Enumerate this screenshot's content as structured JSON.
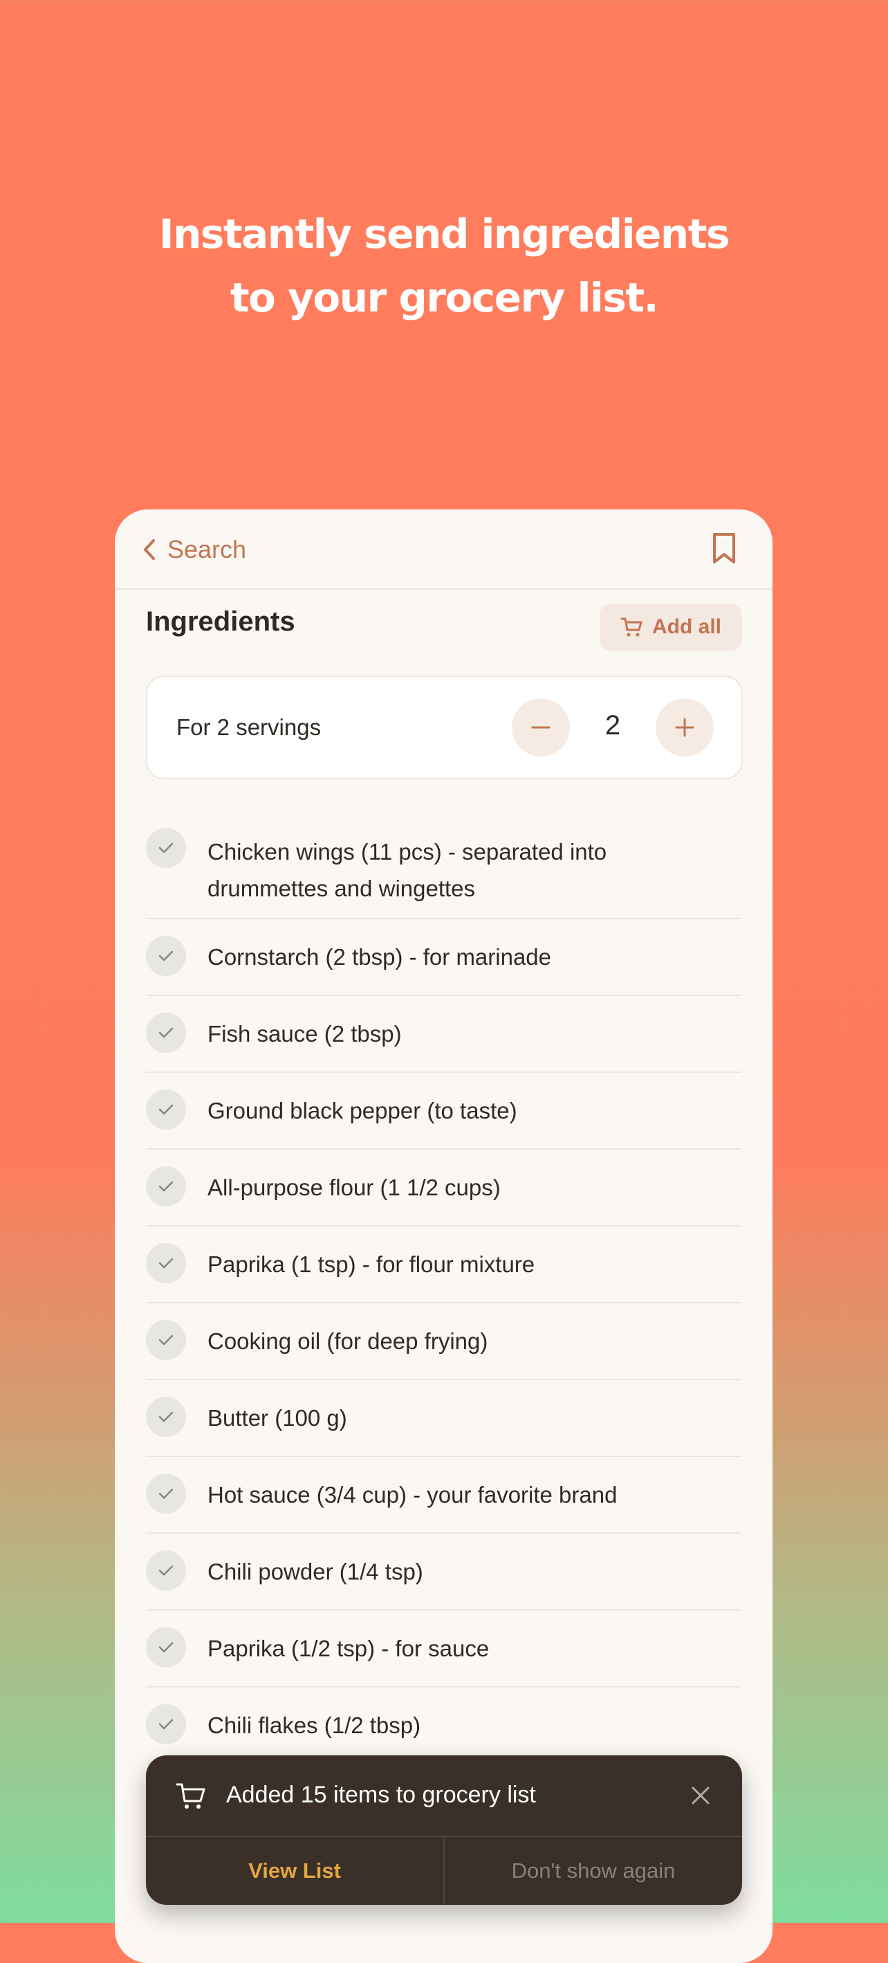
{
  "headline": {
    "line1": "Instantly send ingredients",
    "line2": "to your grocery list."
  },
  "nav": {
    "back_label": "Search",
    "back_icon": "chevron-left-icon",
    "bookmark_icon": "bookmark-icon"
  },
  "ingredients_section": {
    "title": "Ingredients",
    "add_all_label": "Add all",
    "add_all_icon": "cart-icon"
  },
  "servings": {
    "label": "For 2 servings",
    "count": "2"
  },
  "ingredients": [
    "Chicken wings (11 pcs) - separated into drummettes and wingettes",
    "Cornstarch (2 tbsp) - for marinade",
    "Fish sauce (2 tbsp)",
    "Ground black pepper (to taste)",
    "All-purpose flour (1 1/2 cups)",
    "Paprika (1 tsp) - for flour mixture",
    "Cooking oil (for deep frying)",
    "Butter (100 g)",
    "Hot sauce (3/4 cup) - your favorite brand",
    "Chili powder (1/4 tsp)",
    "Paprika (1/2 tsp) - for sauce",
    "Chili flakes (1/2 tbsp)"
  ],
  "toast": {
    "message": "Added 15 items to grocery list",
    "view_list": "View List",
    "dont_show": "Don't show again"
  },
  "colors": {
    "accent": "#C27552",
    "toast_bg": "#3A3028",
    "view_list": "#E2A73F",
    "gradient_top": "#FF7D5C",
    "gradient_bottom": "#7FDC9E"
  }
}
